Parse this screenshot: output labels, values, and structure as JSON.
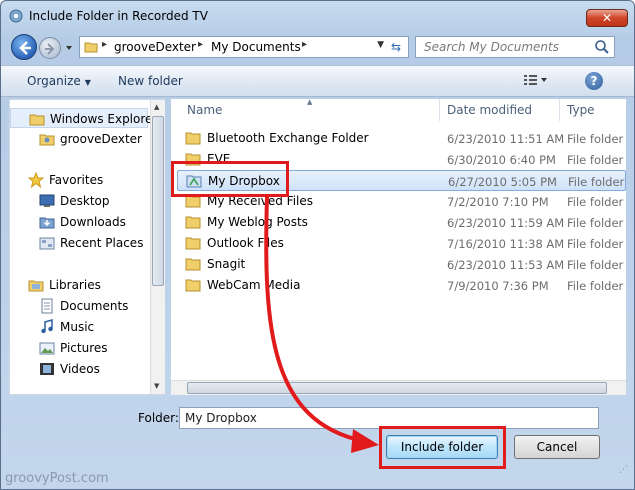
{
  "window": {
    "title": "Include Folder in Recorded TV",
    "close_label": "✕"
  },
  "address": {
    "crumbs": [
      "grooveDexter",
      "My Documents"
    ],
    "search_placeholder": "Search My Documents"
  },
  "toolbar": {
    "organize": "Organize",
    "new_folder": "New folder"
  },
  "navpane": {
    "items": [
      {
        "label": "Windows Explorer",
        "icon": "folder-icon"
      },
      {
        "label": "grooveDexter",
        "icon": "user-folder-icon"
      },
      {
        "label": "Favorites",
        "icon": "star-icon"
      },
      {
        "label": "Desktop",
        "icon": "desktop-icon"
      },
      {
        "label": "Downloads",
        "icon": "downloads-icon"
      },
      {
        "label": "Recent Places",
        "icon": "recent-places-icon"
      },
      {
        "label": "Libraries",
        "icon": "libraries-icon"
      },
      {
        "label": "Documents",
        "icon": "documents-icon"
      },
      {
        "label": "Music",
        "icon": "music-icon"
      },
      {
        "label": "Pictures",
        "icon": "pictures-icon"
      },
      {
        "label": "Videos",
        "icon": "videos-icon"
      }
    ]
  },
  "filelist": {
    "columns": {
      "name": "Name",
      "date": "Date modified",
      "type": "Type"
    },
    "rows": [
      {
        "name": "Bluetooth Exchange Folder",
        "date": "6/23/2010 11:51 AM",
        "type": "File folder"
      },
      {
        "name": "EVE",
        "date": "6/30/2010 6:40 PM",
        "type": "File folder"
      },
      {
        "name": "My Dropbox",
        "date": "6/27/2010 5:05 PM",
        "type": "File folder"
      },
      {
        "name": "My Received Files",
        "date": "7/2/2010 7:10 PM",
        "type": "File folder"
      },
      {
        "name": "My Weblog Posts",
        "date": "6/23/2010 11:59 AM",
        "type": "File folder"
      },
      {
        "name": "Outlook Files",
        "date": "7/16/2010 11:38 AM",
        "type": "File folder"
      },
      {
        "name": "Snagit",
        "date": "6/23/2010 11:53 AM",
        "type": "File folder"
      },
      {
        "name": "WebCam Media",
        "date": "7/9/2010 7:36 PM",
        "type": "File folder"
      }
    ]
  },
  "footer": {
    "folder_label": "Folder:",
    "folder_value": "My Dropbox",
    "include_button": "Include folder",
    "cancel_button": "Cancel",
    "watermark": "groovyPost.com"
  },
  "colors": {
    "annotation": "#e11b1b",
    "selection": "#cfe2f9"
  }
}
